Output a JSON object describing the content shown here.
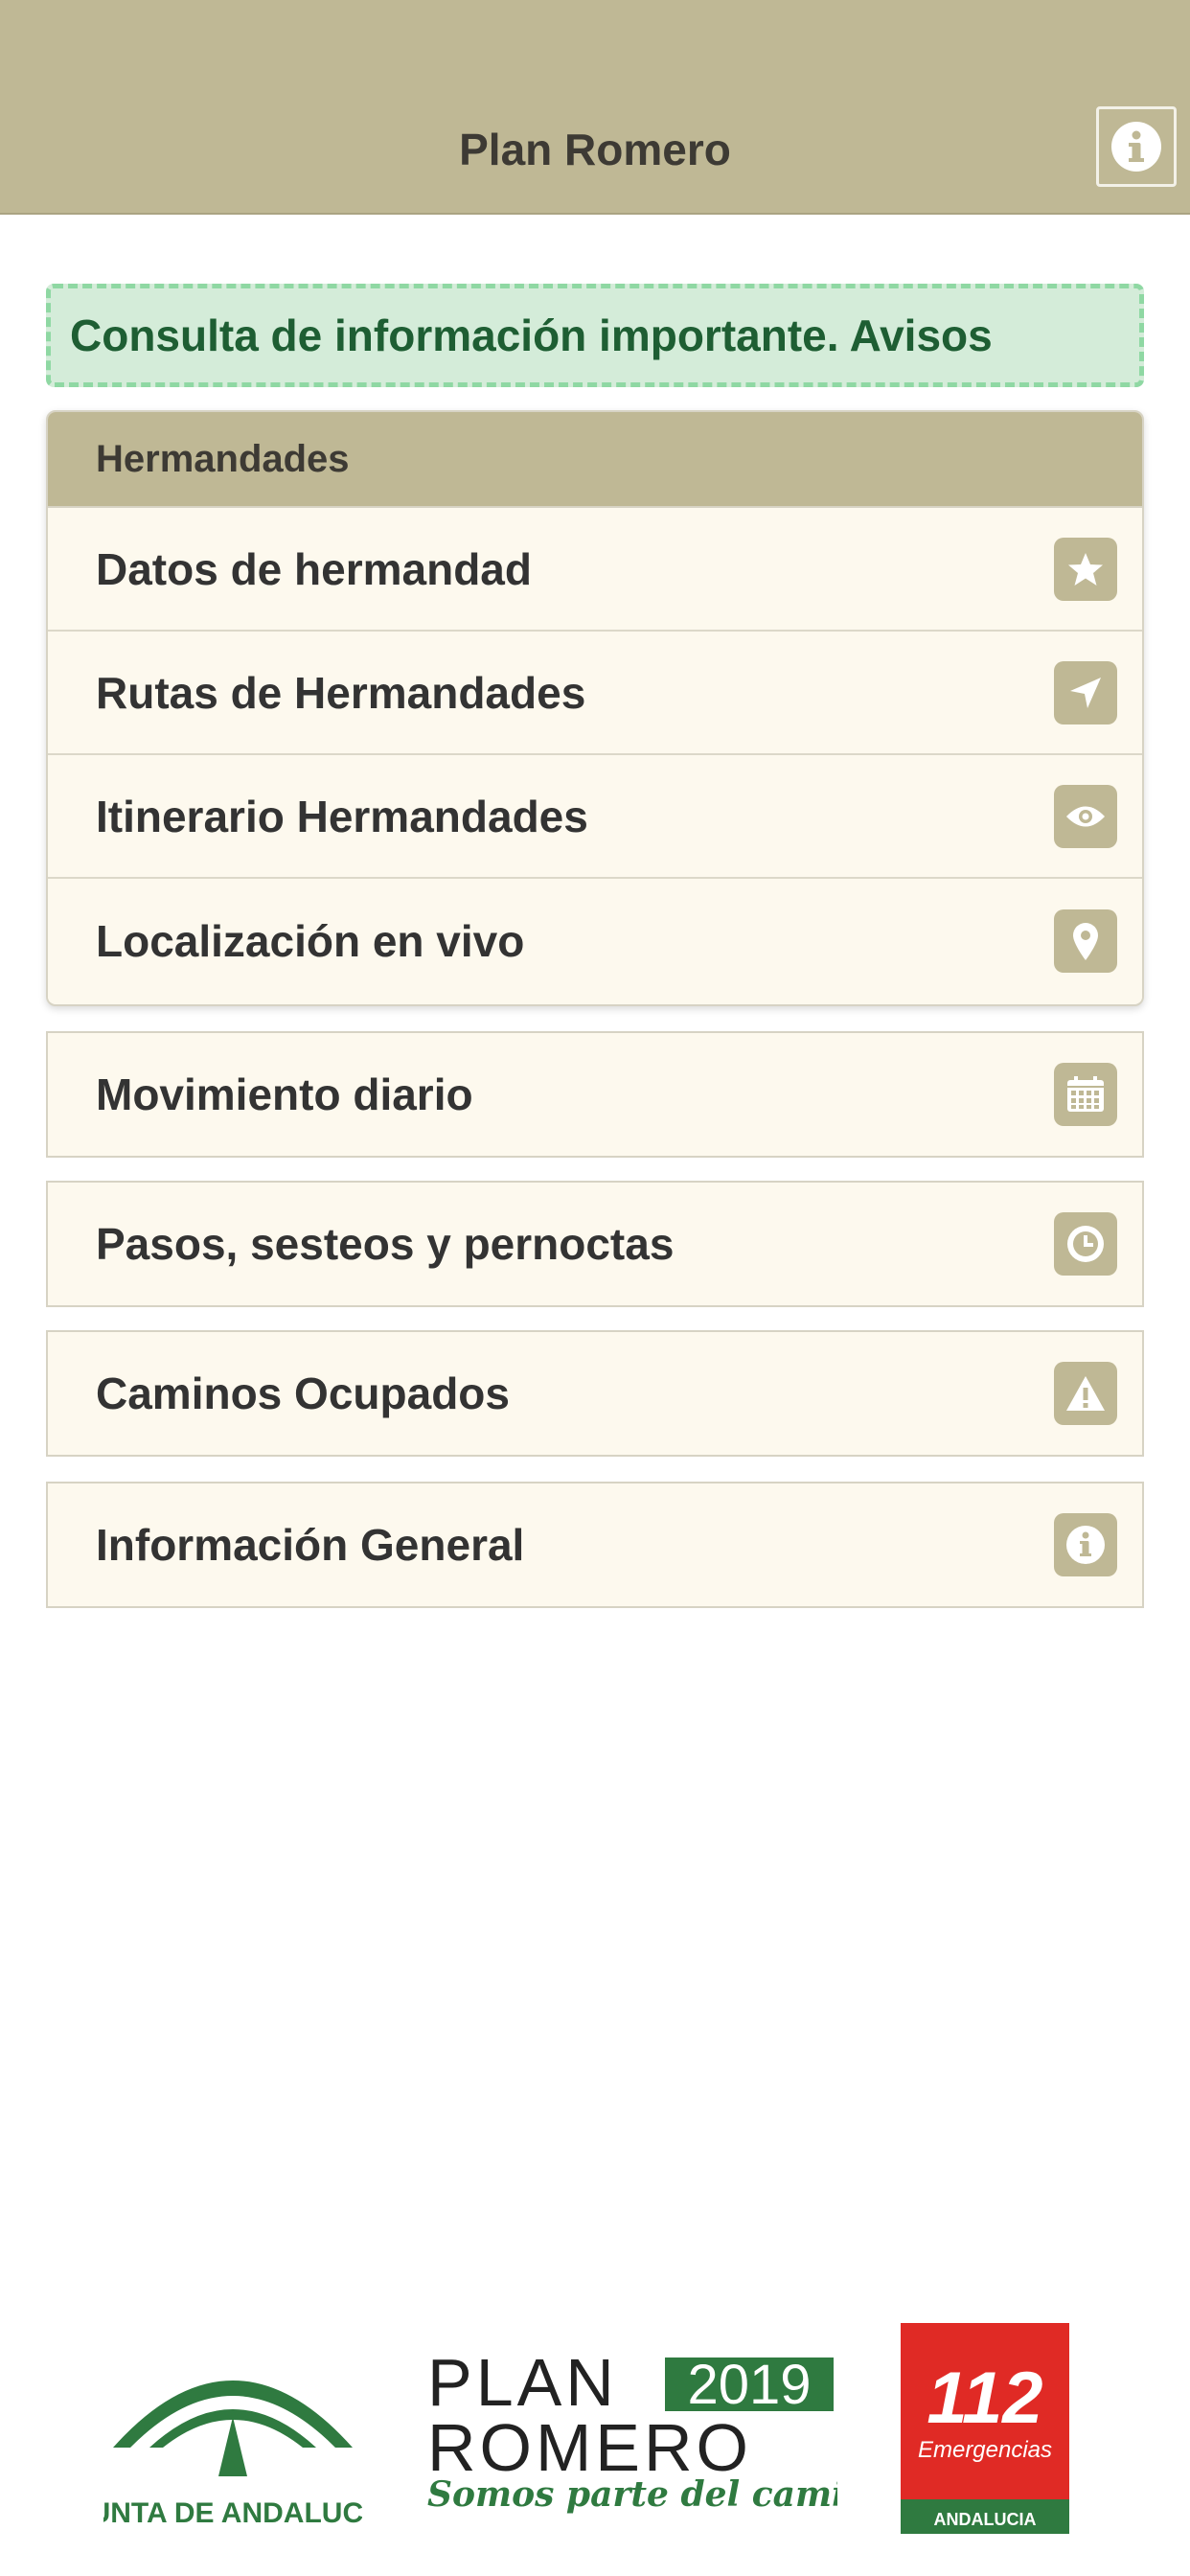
{
  "header": {
    "title": "Plan Romero",
    "info_icon": "info-icon"
  },
  "notice": {
    "text": "Consulta de información importante. Avisos"
  },
  "hermandades": {
    "title": "Hermandades",
    "items": [
      {
        "label": "Datos de hermandad",
        "icon": "star-icon"
      },
      {
        "label": "Rutas de Hermandades",
        "icon": "navigation-arrow-icon"
      },
      {
        "label": "Itinerario Hermandades",
        "icon": "eye-icon"
      },
      {
        "label": "Localización en vivo",
        "icon": "map-pin-icon"
      }
    ]
  },
  "menu": [
    {
      "label": "Movimiento diario",
      "icon": "calendar-icon"
    },
    {
      "label": "Pasos, sesteos y pernoctas",
      "icon": "clock-icon"
    },
    {
      "label": "Caminos Ocupados",
      "icon": "warning-icon"
    },
    {
      "label": "Información General",
      "icon": "info-icon"
    }
  ],
  "footer": {
    "junta": {
      "text": "JUNTA DE ANDALUCIA"
    },
    "plan": {
      "line1": "PLAN",
      "year": "2019",
      "line2": "ROMERO",
      "tagline": "Somos parte del camino"
    },
    "emergencias": {
      "number": "112",
      "label": "Emergencias",
      "region": "ANDALUCIA"
    }
  },
  "colors": {
    "header_bg": "#bfb895",
    "row_bg": "#fdf9ee",
    "notice_bg": "#d4ecd9",
    "notice_border": "#8fd8a3",
    "notice_text": "#1e5e33",
    "brand_green": "#2f7a40",
    "emergency_red": "#e02a25"
  }
}
